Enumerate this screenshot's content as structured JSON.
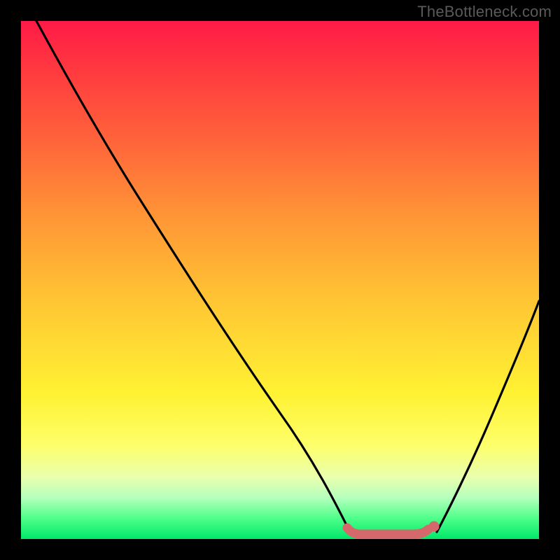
{
  "watermark": "TheBottleneck.com",
  "colors": {
    "curve_stroke": "#000000",
    "marker_stroke": "#d4686b",
    "marker_fill": "#d4686b"
  },
  "chart_data": {
    "type": "line",
    "title": "",
    "xlabel": "",
    "ylabel": "",
    "xlim": [
      0,
      100
    ],
    "ylim": [
      0,
      100
    ],
    "series": [
      {
        "name": "left-curve",
        "x": [
          3,
          10,
          20,
          30,
          40,
          50,
          60,
          62.5,
          65
        ],
        "values": [
          100,
          88,
          72,
          56.5,
          41.5,
          26.5,
          9,
          3,
          0
        ]
      },
      {
        "name": "right-curve",
        "x": [
          80,
          84,
          88,
          92,
          96,
          100
        ],
        "values": [
          0,
          5,
          12,
          22,
          34,
          48
        ]
      },
      {
        "name": "bottom-marker",
        "x": [
          63,
          66,
          70,
          74,
          77,
          79.5
        ],
        "values": [
          0.8,
          0.2,
          0.2,
          0.2,
          0.3,
          1.1
        ]
      }
    ],
    "annotations": [
      {
        "text": "TheBottleneck.com",
        "pos": "top-right"
      }
    ]
  }
}
